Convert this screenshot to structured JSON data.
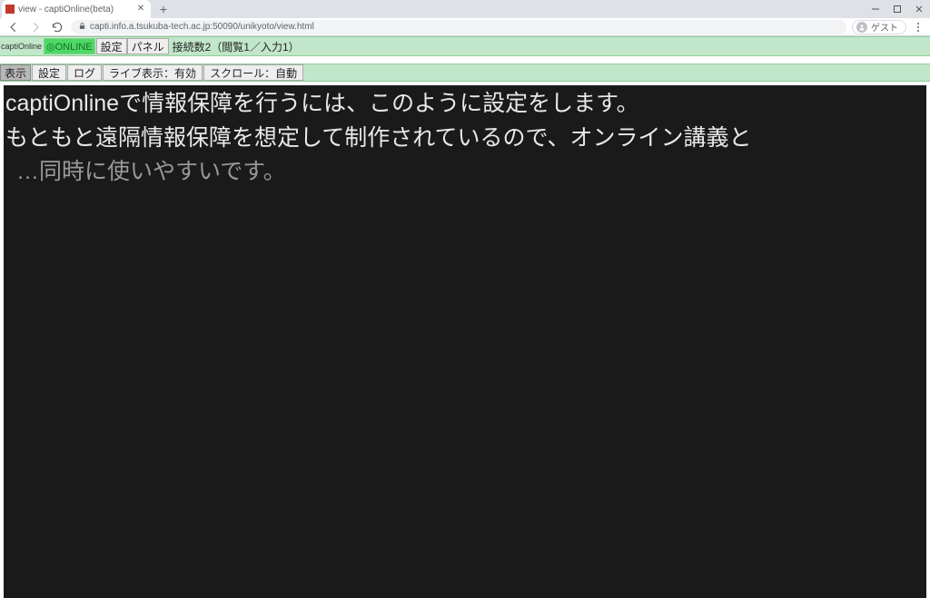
{
  "browser": {
    "tab_title": "view - captiOnline(beta)",
    "url": "capti.info.a.tsukuba-tech.ac.jp:50090/unikyoto/view.html",
    "profile_label": "ゲスト"
  },
  "app_bar1": {
    "brand": "captiOnline",
    "status_chip": "◎ONLINE",
    "btn_settings": "設定",
    "btn_panel": "パネル",
    "connections": "接続数2（閲覧1／入力1）"
  },
  "app_bar2": {
    "btn_view": "表示",
    "btn_settings": "設定",
    "btn_log": "ログ",
    "btn_live": "ライブ表示：有効",
    "btn_scroll": "スクロール：自動"
  },
  "captions": {
    "line1": "captiOnlineで情報保障を行うには、このように設定をします。",
    "line2": "もともと遠隔情報保障を想定して制作されているので、オンライン講義と",
    "line3_typing": "…同時に使いやすいです。"
  }
}
